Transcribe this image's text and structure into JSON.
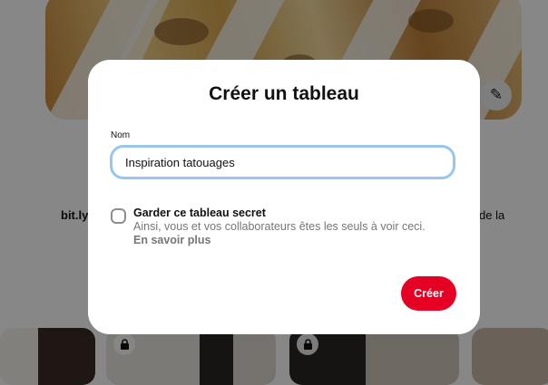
{
  "background": {
    "left_text": "bit.ly",
    "right_text": "de la"
  },
  "modal": {
    "title": "Créer un tableau",
    "name_label": "Nom",
    "name_value": "Inspiration tatouages",
    "secret_title": "Garder ce tableau secret",
    "secret_description": "Ainsi, vous et vos collaborateurs êtes les seuls à voir ceci.",
    "learn_more": "En savoir plus",
    "secret_checked": false,
    "create_button": "Créer"
  },
  "icons": {
    "edit": "pencil-icon",
    "lock": "lock-icon"
  },
  "colors": {
    "primary_button": "#e60023",
    "input_focus_border": "#9ac5ee",
    "secondary_text": "#767676"
  }
}
